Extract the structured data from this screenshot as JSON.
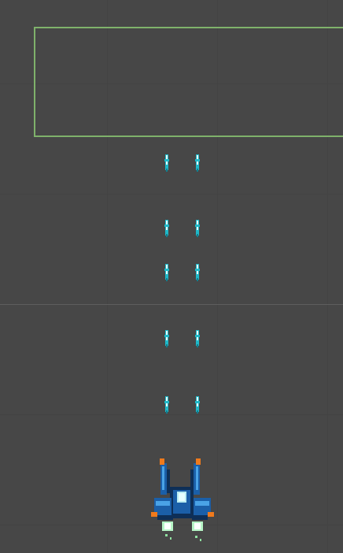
{
  "scene": {
    "colors": {
      "background": "#474747",
      "grid": "#434343",
      "axis": "#5e5e5e",
      "bounds_outline": "#7fb26b",
      "bullet_core": "#e6ffff",
      "bullet_glow": "#1fb8c8",
      "ship_body": "#1b5fa8",
      "ship_dark": "#0e2f57",
      "ship_accent": "#f07a1c",
      "thruster": "#b7f5c7"
    },
    "bullet_pairs": 5,
    "player_ship_icon": "spaceship-icon",
    "bullet_icon": "laser-bullet-icon"
  }
}
